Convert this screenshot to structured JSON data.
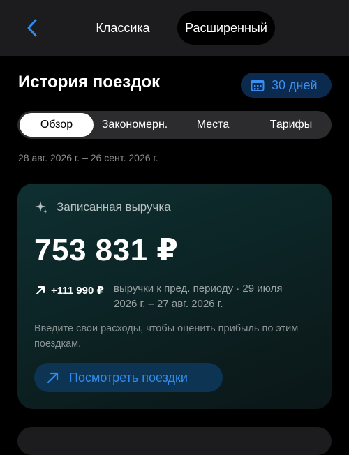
{
  "header": {
    "back_icon": "chevron-left-icon",
    "tabs": [
      {
        "label": "Классика",
        "selected": false
      },
      {
        "label": "Расширенный",
        "selected": true
      }
    ]
  },
  "page": {
    "title": "История поездок",
    "period_label": "30 дней",
    "period_icon": "calendar-icon",
    "segments": [
      {
        "label": "Обзор",
        "selected": true
      },
      {
        "label": "Закономерн.",
        "selected": false
      },
      {
        "label": "Места",
        "selected": false
      },
      {
        "label": "Тарифы",
        "selected": false
      }
    ],
    "date_range": "28 авг. 2026 г. – 26 сент. 2026 г."
  },
  "revenue_card": {
    "icon": "sparkle-icon",
    "title": "Записанная выручка",
    "amount": "753 831 ₽",
    "delta_icon": "arrow-up-right-icon",
    "delta_value": "+111 990 ₽",
    "delta_description": "выручки к пред. периоду · 29 июля 2026 г. – 27 авг. 2026 г.",
    "note": "Введите свои расходы, чтобы оценить прибыль по этим поездкам.",
    "view_button_label": "Посмотреть поездки",
    "view_button_icon": "arrow-up-right-icon"
  },
  "colors": {
    "accent": "#2f8df0",
    "background": "#000000",
    "card_bg": "#0f2f31",
    "topbar_bg": "#1c1c1e"
  }
}
